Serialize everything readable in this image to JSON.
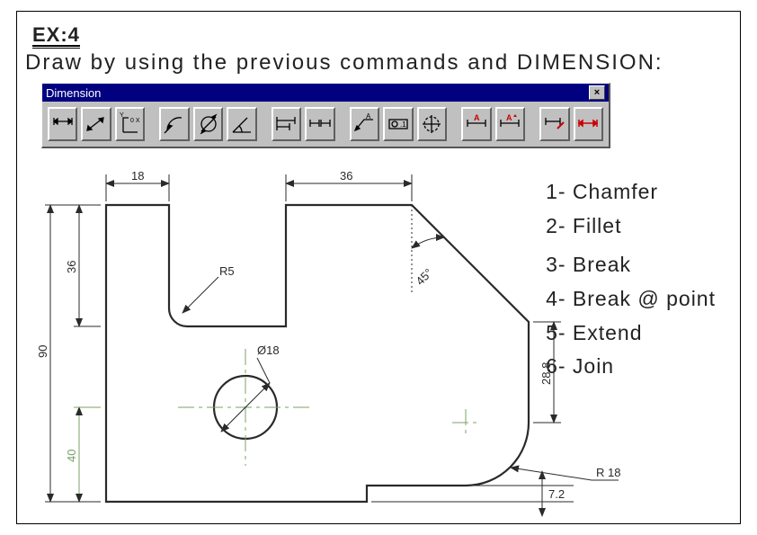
{
  "header": {
    "tag": "EX:4",
    "instruction": "Draw by using the previous commands and DIMENSION:"
  },
  "toolbar": {
    "title": "Dimension",
    "close": "×",
    "icons": [
      "dim-linear",
      "dim-aligned",
      "dim-ordinate",
      "dim-radius",
      "dim-diameter",
      "dim-angular",
      "dim-baseline",
      "dim-continue",
      "dim-leader",
      "dim-tolerance",
      "dim-center",
      "dim-edit",
      "dim-tedit",
      "dim-style",
      "dim-update"
    ]
  },
  "commands": [
    "1- Chamfer",
    "2- Fillet",
    "3- Break",
    "4- Break @ point",
    "5- Extend",
    "6- Join"
  ],
  "dimensions": {
    "top_left": "18",
    "top_right": "36",
    "left_full": "90",
    "left_upper": "36",
    "left_lower": "40",
    "fillet_r": "R5",
    "diameter": "Ø18",
    "angle": "45°",
    "right_small": "28.8",
    "fillet_big": "R 18",
    "bottom_small": "7.2"
  }
}
